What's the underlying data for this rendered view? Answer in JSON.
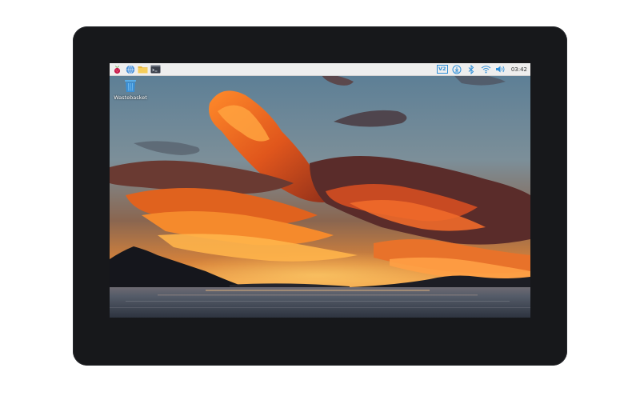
{
  "taskbar": {
    "launchers": [
      {
        "icon": "raspberry-menu-icon"
      },
      {
        "icon": "web-browser-icon"
      },
      {
        "icon": "file-manager-icon"
      },
      {
        "icon": "terminal-icon"
      }
    ],
    "tray": {
      "vnc_label": "V2",
      "icons": [
        "vnc-icon",
        "updater-icon",
        "bluetooth-icon",
        "wifi-icon",
        "volume-icon"
      ],
      "clock": "03:42"
    }
  },
  "desktop": {
    "icons": [
      {
        "label": "Wastebasket",
        "icon": "wastebasket-icon"
      }
    ],
    "wallpaper": "sunset-over-lake"
  },
  "colors": {
    "bezel": "#17181b",
    "taskbar": "#eeeeee",
    "accent_blue": "#2f8fd8",
    "raspberry_red": "#c51a4a"
  }
}
